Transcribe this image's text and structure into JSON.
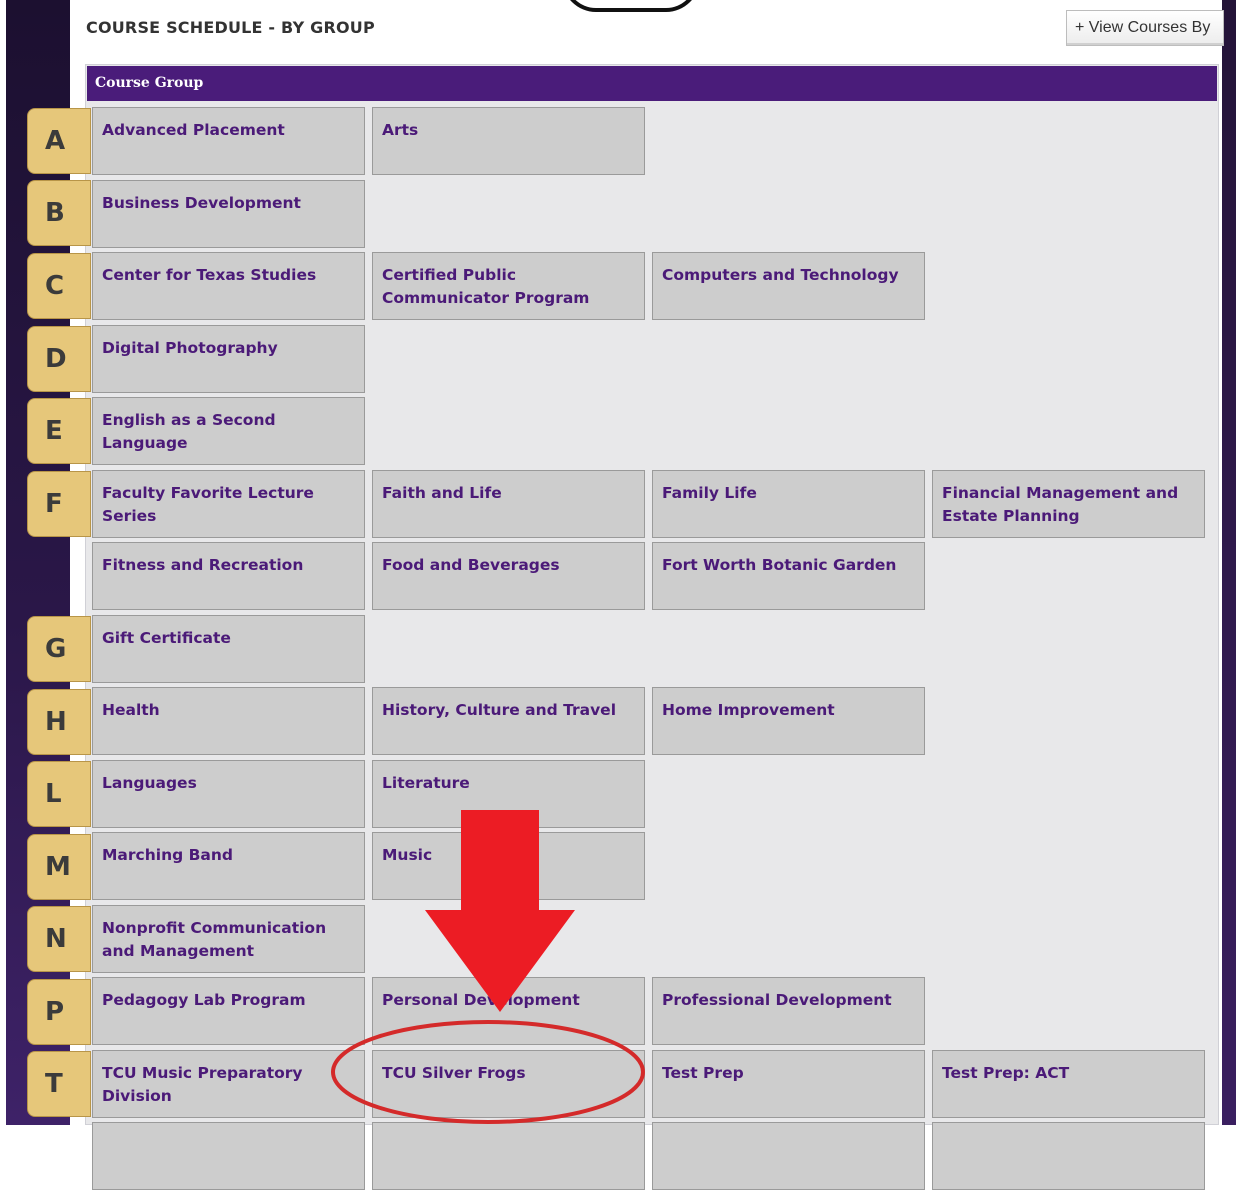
{
  "header": {
    "title": "COURSE SCHEDULE - BY GROUP",
    "view_button": "+ View Courses By"
  },
  "panel": {
    "heading": "Course Group"
  },
  "letters": [
    "A",
    "B",
    "C",
    "D",
    "E",
    "F",
    "G",
    "H",
    "L",
    "M",
    "N",
    "P",
    "T"
  ],
  "groups": [
    [
      "Advanced Placement",
      "Arts"
    ],
    [
      "Business Development"
    ],
    [
      "Center for Texas Studies",
      "Certified Public Communicator Program",
      "Computers and Technology"
    ],
    [
      "Digital Photography"
    ],
    [
      "English as a Second Language"
    ],
    [
      "Faculty Favorite Lecture Series",
      "Faith and Life",
      "Family Life",
      "Financial Management and Estate Planning"
    ],
    [
      "Fitness and Recreation",
      "Food and Beverages",
      "Fort Worth Botanic Garden"
    ],
    [
      "Gift Certificate"
    ],
    [
      "Health",
      "History, Culture and Travel",
      "Home Improvement"
    ],
    [
      "Languages",
      "Literature"
    ],
    [
      "Marching Band",
      "Music"
    ],
    [
      "Nonprofit Communication and Management"
    ],
    [
      "Pedagogy Lab Program",
      "Personal Development",
      "Professional Development"
    ],
    [
      "TCU Music Preparatory Division",
      "TCU Silver Frogs",
      "Test Prep",
      "Test Prep: ACT"
    ]
  ],
  "annotation": {
    "arrow_color": "#ec1c24",
    "highlight_color": "#d42a2a",
    "highlighted_item": "TCU Silver Frogs"
  }
}
